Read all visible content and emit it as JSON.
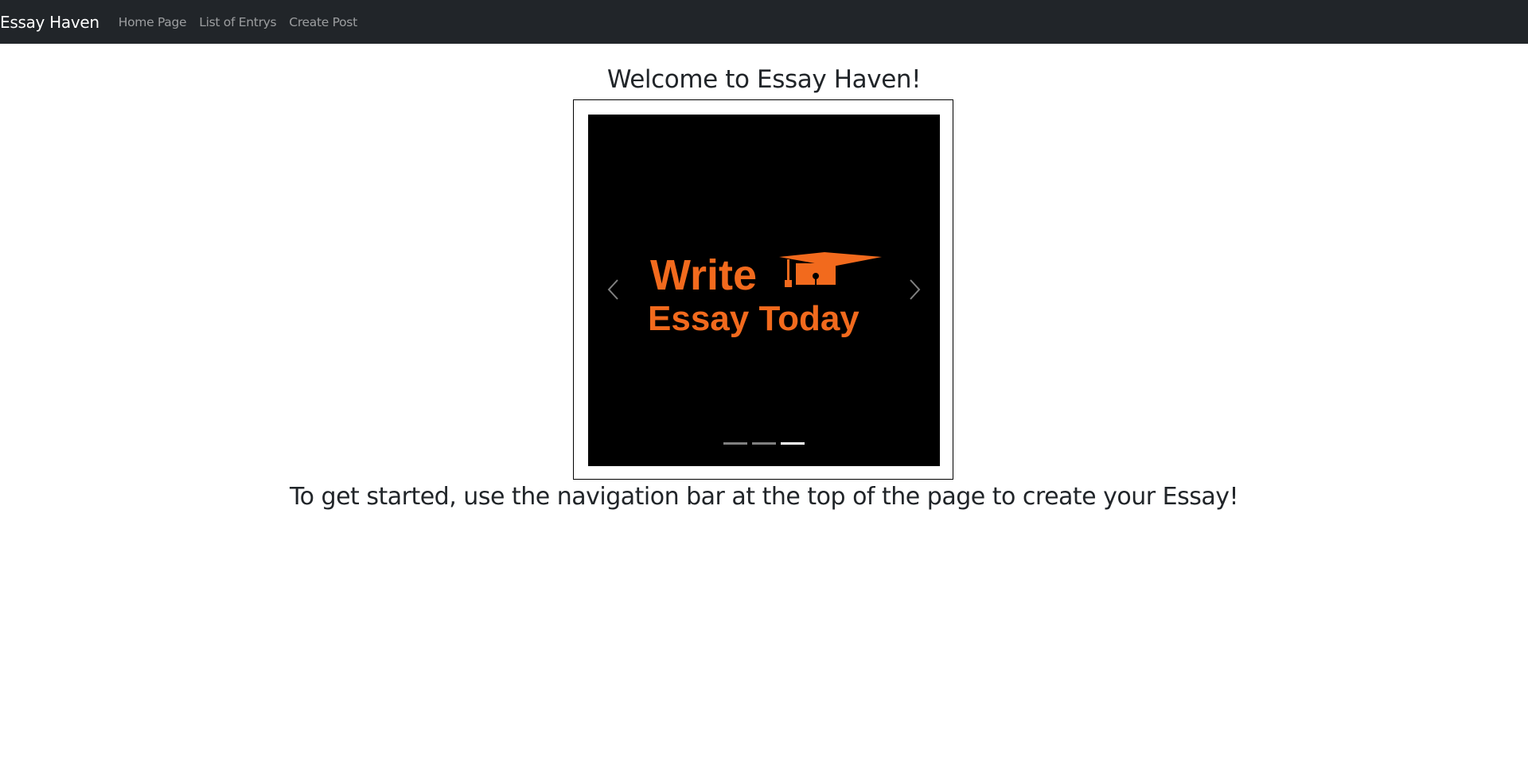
{
  "navbar": {
    "brand": "Essay Haven",
    "links": [
      "Home Page",
      "List of Entrys",
      "Create Post"
    ]
  },
  "main": {
    "welcome_heading": "Welcome to Essay Haven!",
    "instructions": "To get started, use the navigation bar at the top of the page to create your Essay!"
  },
  "carousel": {
    "slide_logo_line1": "Write",
    "slide_logo_line2": "Essay Today",
    "slide_count": 3,
    "active_slide": 3,
    "prev_icon": "chevron-left-icon",
    "next_icon": "chevron-right-icon"
  },
  "colors": {
    "navbar_bg": "#212529",
    "logo_orange": "#f26a1d",
    "slide_bg": "#000000"
  }
}
